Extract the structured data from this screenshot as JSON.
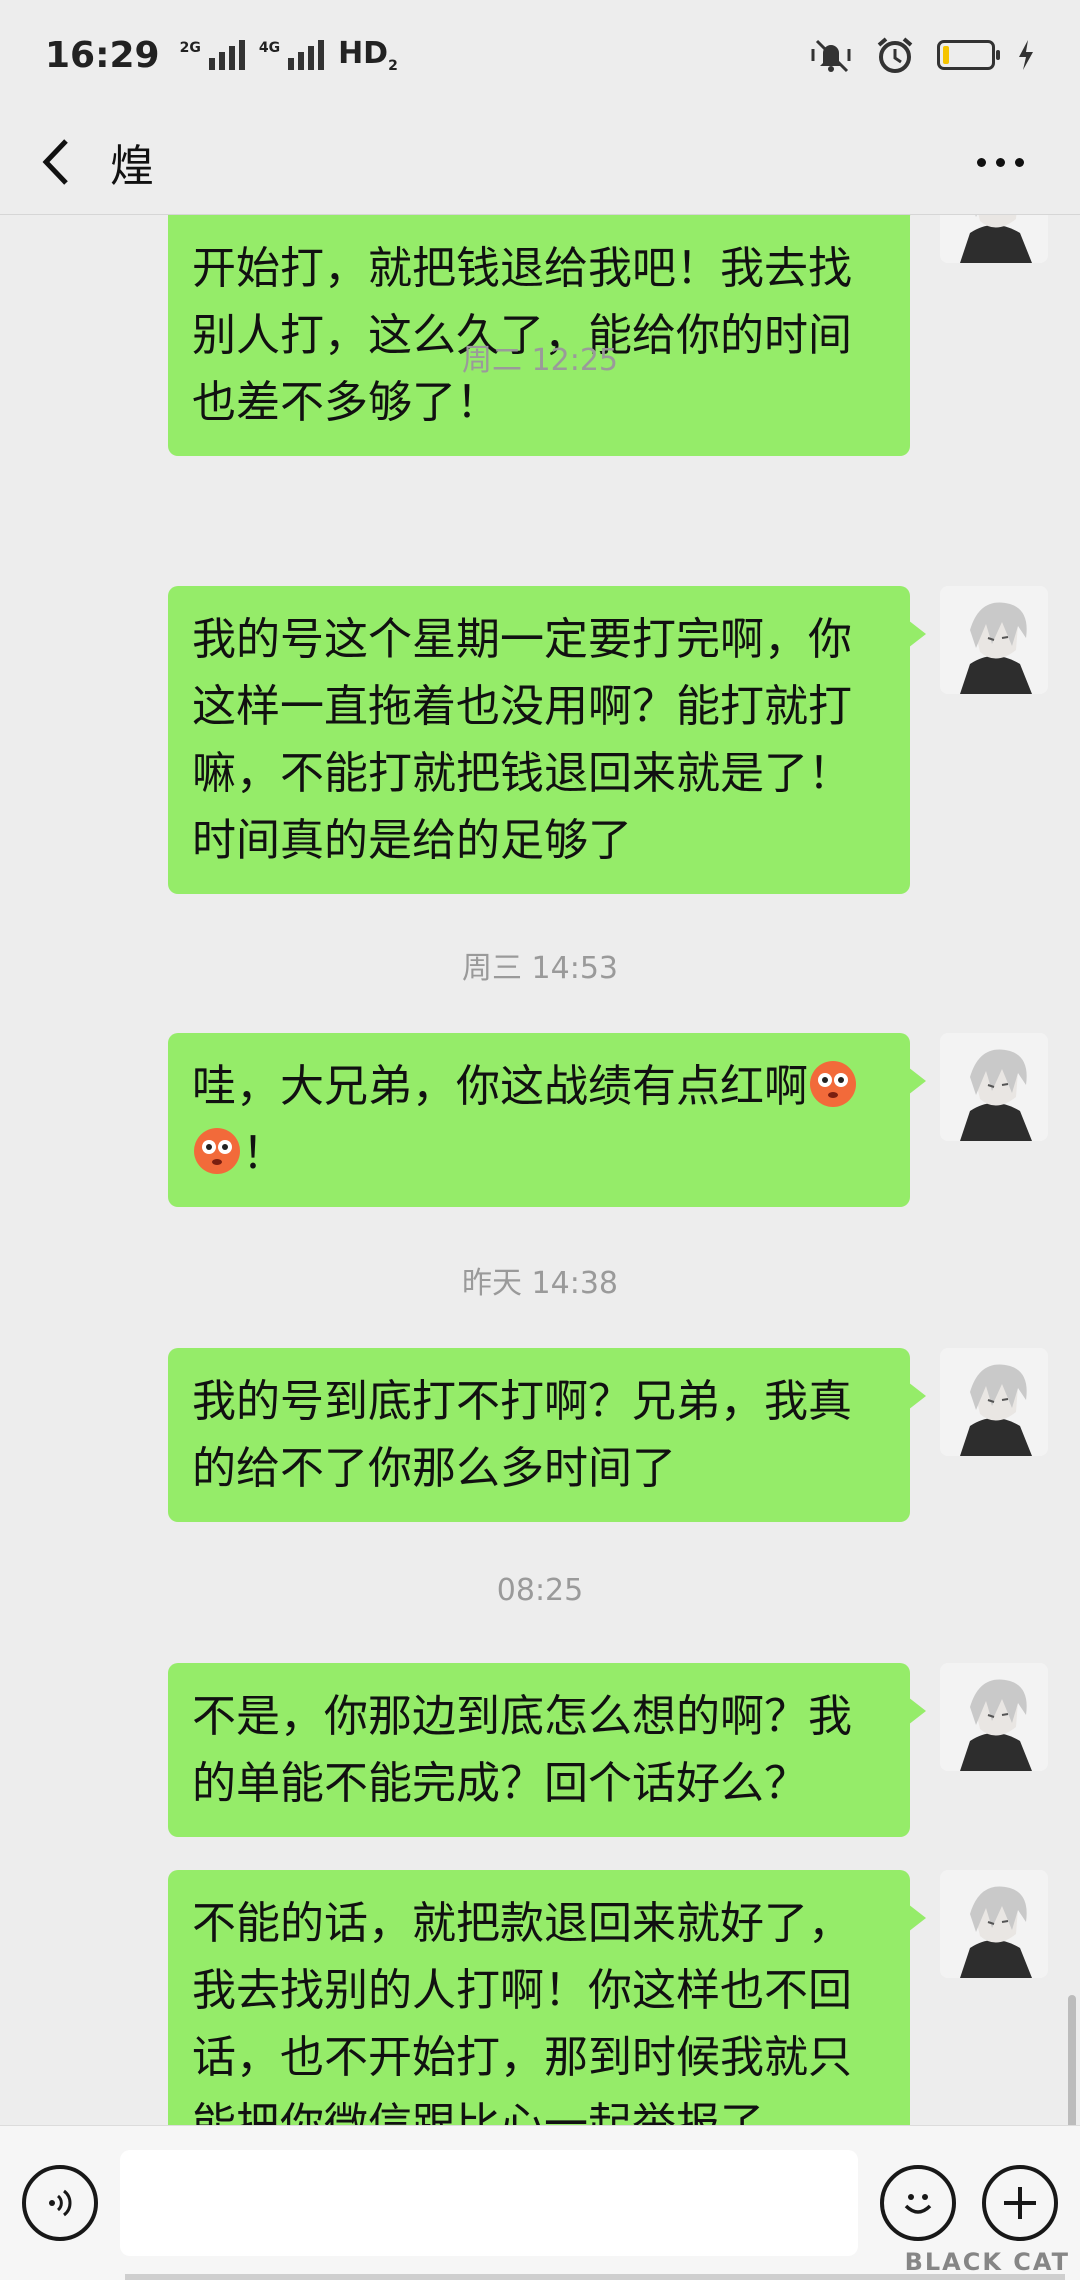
{
  "status_bar": {
    "time": "16:29",
    "net1": "2G",
    "net2": "4G",
    "hd": "HD",
    "hd_sub": "2"
  },
  "header": {
    "title": "煌"
  },
  "messages": [
    {
      "type": "out",
      "text": "开始打，就把钱退给我吧！我去找别人打，这么久了，能给你的时间也差不多够了！"
    },
    {
      "type": "time",
      "text": "周二 12:25"
    },
    {
      "type": "out",
      "text": "我的号这个星期一定要打完啊，你这样一直拖着也没用啊？能打就打嘛，不能打就把钱退回来就是了！时间真的是给的足够了"
    },
    {
      "type": "time",
      "text": "周三 14:53"
    },
    {
      "type": "out",
      "text_before": "哇，大兄弟，你这战绩有点红啊",
      "text_after": "！"
    },
    {
      "type": "time",
      "text": "昨天 14:38"
    },
    {
      "type": "out",
      "text": "我的号到底打不打啊？兄弟，我真的给不了你那么多时间了"
    },
    {
      "type": "time",
      "text": "08:25"
    },
    {
      "type": "out",
      "text": "不是，你那边到底怎么想的啊？我的单能不能完成？回个话好么？"
    },
    {
      "type": "out",
      "text": "不能的话，就把款退回来就好了，我去找别的人打啊！你这样也不回话，也不开始打，那到时候我就只能把你微信跟比心一起举报了"
    }
  ],
  "input": {
    "placeholder": ""
  },
  "watermark": "BLACK CAT",
  "colors": {
    "background": "#ededed",
    "bubble_out": "#95ec69",
    "timestamp": "#9a9a9a"
  },
  "icons": [
    "back-arrow-icon",
    "more-icon",
    "voice-icon",
    "emoji-icon",
    "plus-icon",
    "flushed-face-emoji"
  ]
}
